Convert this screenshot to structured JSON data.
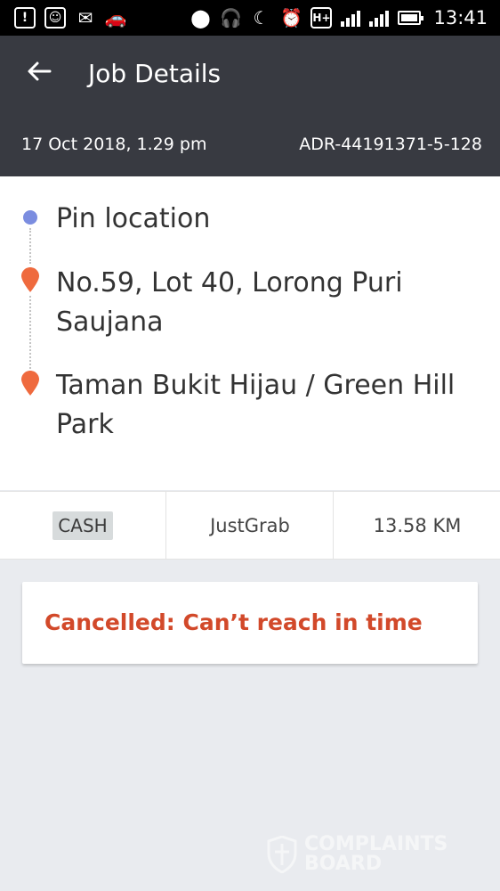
{
  "status_bar": {
    "time": "13:41",
    "network_label": "H+",
    "icons": [
      "alert-icon",
      "face-icon",
      "mail-icon",
      "car-icon",
      "location-icon",
      "headset-icon",
      "moon-icon",
      "alarm-icon",
      "hplus-icon",
      "signal-icon",
      "battery-charging-icon"
    ]
  },
  "header": {
    "title": "Job Details",
    "date": "17 Oct 2018, 1.29 pm",
    "reference": "ADR-44191371-5-128"
  },
  "route": {
    "stops": [
      {
        "label": "Pin location",
        "marker": "blue-dot"
      },
      {
        "label": "No.59, Lot 40, Lorong Puri Saujana",
        "marker": "orange-pin"
      },
      {
        "label": "Taman Bukit Hijau / Green Hill Park",
        "marker": "orange-pin"
      }
    ]
  },
  "info": {
    "payment": "CASH",
    "service": "JustGrab",
    "distance": "13.58 KM"
  },
  "status": {
    "text": "Cancelled: Can’t reach in time"
  },
  "watermark": {
    "line1": "COMPLAINTS",
    "line2": "BOARD"
  },
  "colors": {
    "header_bg": "#383a41",
    "status_text": "#d2492a",
    "pin": "#ef6a3e",
    "origin_dot": "#7b8de0",
    "page_bg": "#e9ebef"
  }
}
